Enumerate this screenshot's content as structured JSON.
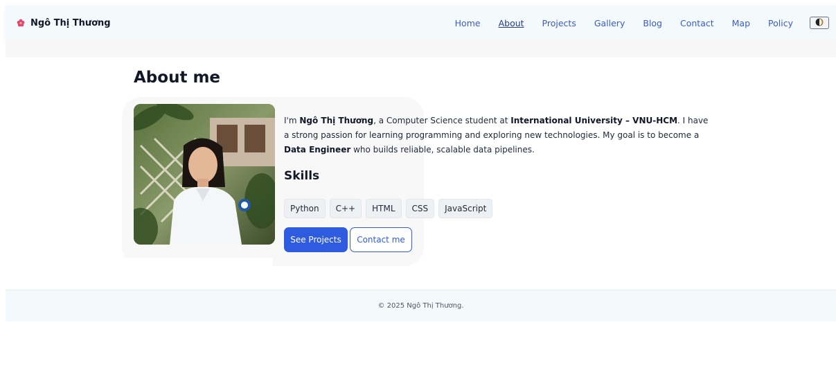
{
  "brand": {
    "name": "Ngô Thị Thương",
    "icon": "flower-icon",
    "icon_color": "#e0457b"
  },
  "nav": {
    "items": [
      {
        "label": "Home",
        "active": false
      },
      {
        "label": "About",
        "active": true
      },
      {
        "label": "Projects",
        "active": false
      },
      {
        "label": "Gallery",
        "active": false
      },
      {
        "label": "Blog",
        "active": false
      },
      {
        "label": "Contact",
        "active": false
      },
      {
        "label": "Map",
        "active": false
      },
      {
        "label": "Policy",
        "active": false
      }
    ],
    "theme_toggle_icon": "half-moon-icon"
  },
  "about": {
    "title": "About me",
    "bio": {
      "p1": "I'm ",
      "name": "Ngô Thị Thương",
      "p2": ", a Computer Science student at ",
      "school": "International University – VNU-HCM",
      "p3": ". I have a strong passion for learning programming and exploring new technologies. My goal is to become a ",
      "role": "Data Engineer",
      "p4": " who builds reliable, scalable data pipelines."
    },
    "skills_title": "Skills",
    "skills": [
      "Python",
      "C++",
      "HTML",
      "CSS",
      "JavaScript"
    ],
    "buttons": {
      "primary": "See Projects",
      "secondary": "Contact me"
    }
  },
  "footer": {
    "text": "© 2025 Ngô Thị Thương."
  },
  "colors": {
    "accent": "#2f5be0",
    "header_bg": "#f4f9fb",
    "nav_link": "#3b5bcc"
  }
}
